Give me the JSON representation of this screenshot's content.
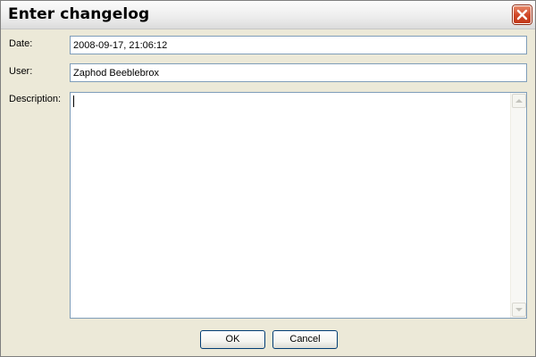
{
  "window": {
    "title": "Enter changelog"
  },
  "form": {
    "date_label": "Date:",
    "date_value": "2008-09-17, 21:06:12",
    "user_label": "User:",
    "user_value": "Zaphod Beeblebrox",
    "description_label": "Description:",
    "description_value": ""
  },
  "buttons": {
    "ok_label": "OK",
    "cancel_label": "Cancel"
  },
  "icons": {
    "close": "close-icon",
    "scroll_up": "scroll-up-arrow-icon",
    "scroll_down": "scroll-down-arrow-icon"
  },
  "colors": {
    "dialog_background": "#ece9d8",
    "field_border": "#7f9db9",
    "close_button": "#d2492a",
    "button_border": "#003c74"
  }
}
